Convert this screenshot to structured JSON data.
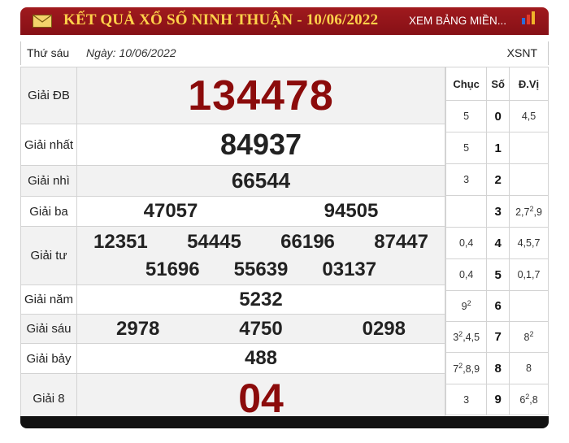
{
  "header": {
    "title": "KẾT QUẢ XỔ SỐ NINH THUẬN - 10/06/2022",
    "link": "XEM BẢNG MIỀN...",
    "colors": {
      "bar": "#9a161b",
      "title": "#ffd24a",
      "number_red": "#8b0b0b"
    }
  },
  "info": {
    "day": "Thứ sáu",
    "date": "Ngày: 10/06/2022",
    "code": "XSNT"
  },
  "prizes": {
    "db": {
      "label": "Giải ĐB",
      "numbers": [
        "134478"
      ]
    },
    "nhat": {
      "label": "Giải nhất",
      "numbers": [
        "84937"
      ]
    },
    "nhi": {
      "label": "Giải nhì",
      "numbers": [
        "66544"
      ]
    },
    "ba": {
      "label": "Giải ba",
      "numbers": [
        "47057",
        "94505"
      ]
    },
    "tu": {
      "label": "Giải tư",
      "numbers": [
        "12351",
        "54445",
        "66196",
        "87447",
        "51696",
        "55639",
        "03137"
      ]
    },
    "nam": {
      "label": "Giải năm",
      "numbers": [
        "5232"
      ]
    },
    "sau": {
      "label": "Giải sáu",
      "numbers": [
        "2978",
        "4750",
        "0298"
      ]
    },
    "bay": {
      "label": "Giải bảy",
      "numbers": [
        "488"
      ]
    },
    "tam": {
      "label": "Giải 8",
      "numbers": [
        "04"
      ]
    }
  },
  "loto": {
    "headers": [
      "Chục",
      "Số",
      "Đ.Vị"
    ],
    "rows": [
      {
        "chuc": "5",
        "chuc_sup": "",
        "chuc_tail": "",
        "so": "0",
        "dv": "4,5",
        "dv_sup": "",
        "dv_tail": ""
      },
      {
        "chuc": "5",
        "chuc_sup": "",
        "chuc_tail": "",
        "so": "1",
        "dv": "",
        "dv_sup": "",
        "dv_tail": ""
      },
      {
        "chuc": "3",
        "chuc_sup": "",
        "chuc_tail": "",
        "so": "2",
        "dv": "",
        "dv_sup": "",
        "dv_tail": ""
      },
      {
        "chuc": "",
        "chuc_sup": "",
        "chuc_tail": "",
        "so": "3",
        "dv": "2,7",
        "dv_sup": "2",
        "dv_tail": ",9"
      },
      {
        "chuc": "0,4",
        "chuc_sup": "",
        "chuc_tail": "",
        "so": "4",
        "dv": "4,5,7",
        "dv_sup": "",
        "dv_tail": ""
      },
      {
        "chuc": "0,4",
        "chuc_sup": "",
        "chuc_tail": "",
        "so": "5",
        "dv": "0,1,7",
        "dv_sup": "",
        "dv_tail": ""
      },
      {
        "chuc": "9",
        "chuc_sup": "2",
        "chuc_tail": "",
        "so": "6",
        "dv": "",
        "dv_sup": "",
        "dv_tail": ""
      },
      {
        "chuc": "3",
        "chuc_sup": "2",
        "chuc_tail": ",4,5",
        "so": "7",
        "dv": "8",
        "dv_sup": "2",
        "dv_tail": ""
      },
      {
        "chuc": "7",
        "chuc_sup": "2",
        "chuc_tail": ",8,9",
        "so": "8",
        "dv": "8",
        "dv_sup": "",
        "dv_tail": ""
      },
      {
        "chuc": "3",
        "chuc_sup": "",
        "chuc_tail": "",
        "so": "9",
        "dv": "6",
        "dv_sup": "2",
        "dv_tail": ",8"
      }
    ]
  }
}
